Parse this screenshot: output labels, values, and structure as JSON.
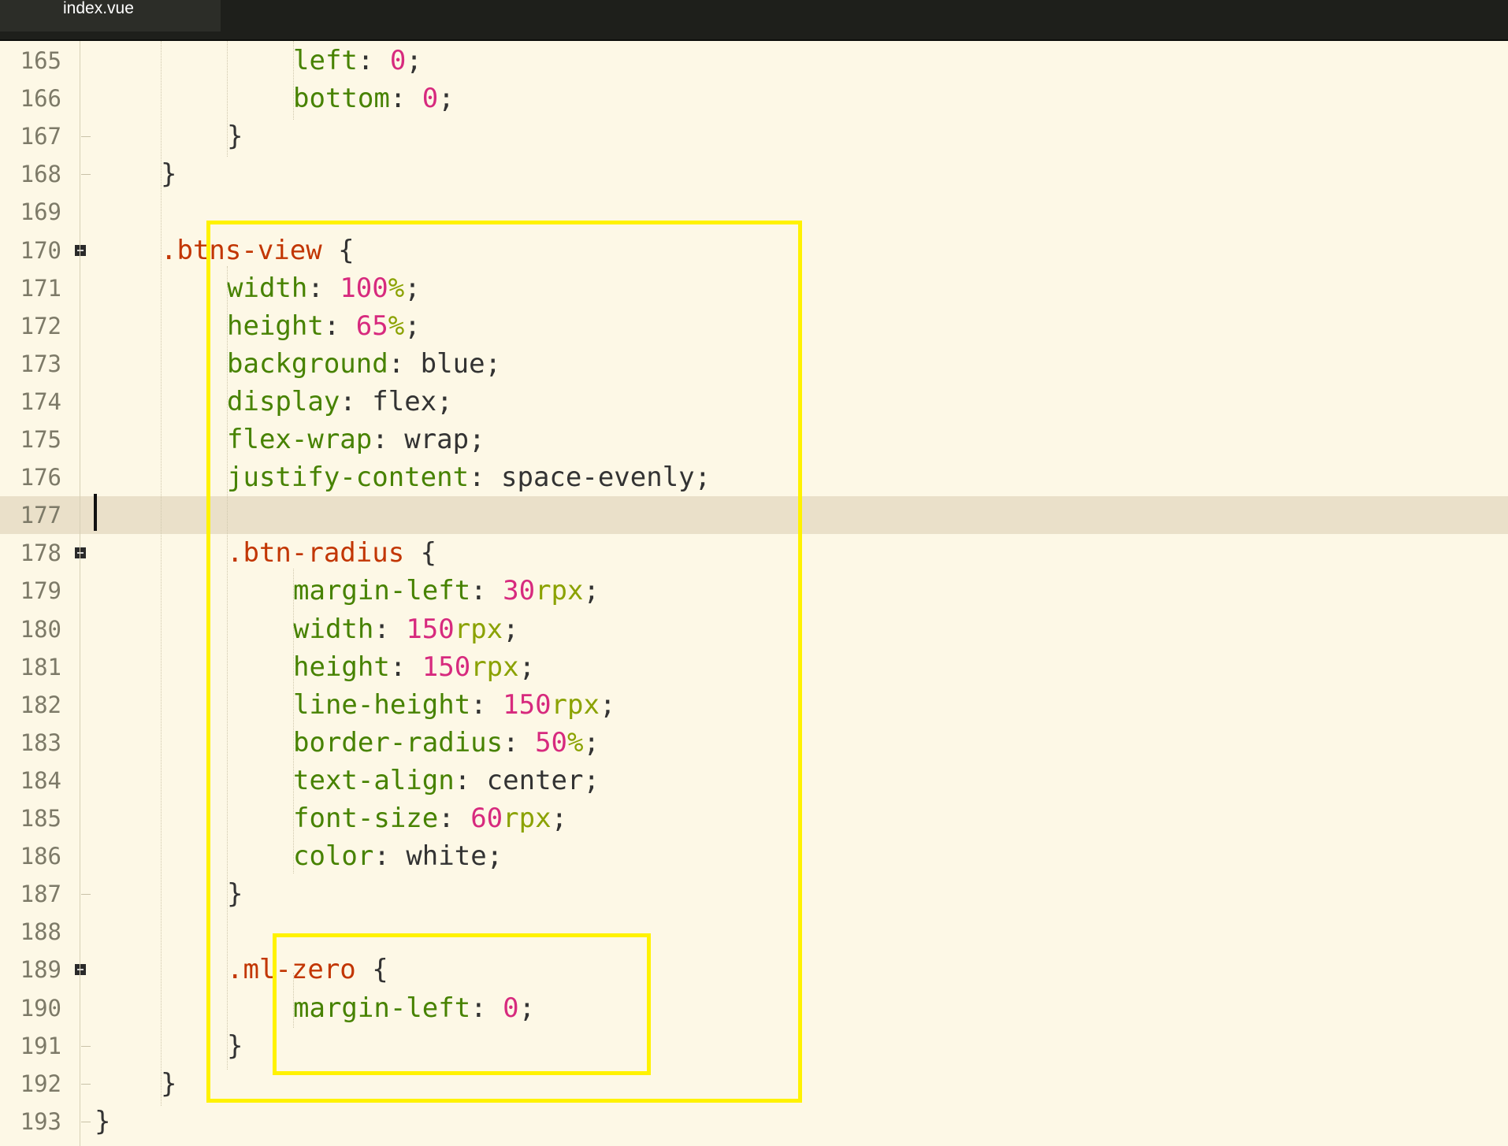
{
  "tab": {
    "filename": "index.vue"
  },
  "colors": {
    "background": "#FDF8E6",
    "active_line": "#EAE0C9",
    "property": "#478200",
    "number": "#D72A7E",
    "unit": "#8BA202",
    "selector": "#C23603",
    "highlight_box": "#FFF200"
  },
  "editor": {
    "lines": [
      {
        "number": "165",
        "tokens": [
          {
            "t": "left",
            "c": "prop"
          },
          {
            "t": ": ",
            "c": "punc"
          },
          {
            "t": "0",
            "c": "num"
          },
          {
            "t": ";",
            "c": "punc"
          }
        ]
      },
      {
        "number": "166",
        "tokens": [
          {
            "t": "bottom",
            "c": "prop"
          },
          {
            "t": ": ",
            "c": "punc"
          },
          {
            "t": "0",
            "c": "num"
          },
          {
            "t": ";",
            "c": "punc"
          }
        ]
      },
      {
        "number": "167",
        "tokens": [
          {
            "t": "}",
            "c": "punc"
          }
        ]
      },
      {
        "number": "168",
        "tokens": [
          {
            "t": "}",
            "c": "punc"
          }
        ]
      },
      {
        "number": "169",
        "tokens": []
      },
      {
        "number": "170",
        "tokens": [
          {
            "t": ".btns-view",
            "c": "sel"
          },
          {
            "t": " {",
            "c": "punc"
          }
        ]
      },
      {
        "number": "171",
        "tokens": [
          {
            "t": "width",
            "c": "prop"
          },
          {
            "t": ": ",
            "c": "punc"
          },
          {
            "t": "100",
            "c": "num"
          },
          {
            "t": "%",
            "c": "unit"
          },
          {
            "t": ";",
            "c": "punc"
          }
        ]
      },
      {
        "number": "172",
        "tokens": [
          {
            "t": "height",
            "c": "prop"
          },
          {
            "t": ": ",
            "c": "punc"
          },
          {
            "t": "65",
            "c": "num"
          },
          {
            "t": "%",
            "c": "unit"
          },
          {
            "t": ";",
            "c": "punc"
          }
        ]
      },
      {
        "number": "173",
        "tokens": [
          {
            "t": "background",
            "c": "prop"
          },
          {
            "t": ": ",
            "c": "punc"
          },
          {
            "t": "blue",
            "c": "kw"
          },
          {
            "t": ";",
            "c": "punc"
          }
        ]
      },
      {
        "number": "174",
        "tokens": [
          {
            "t": "display",
            "c": "prop"
          },
          {
            "t": ": ",
            "c": "punc"
          },
          {
            "t": "flex",
            "c": "kw"
          },
          {
            "t": ";",
            "c": "punc"
          }
        ]
      },
      {
        "number": "175",
        "tokens": [
          {
            "t": "flex-wrap",
            "c": "prop"
          },
          {
            "t": ": ",
            "c": "punc"
          },
          {
            "t": "wrap",
            "c": "kw"
          },
          {
            "t": ";",
            "c": "punc"
          }
        ]
      },
      {
        "number": "176",
        "tokens": [
          {
            "t": "justify-content",
            "c": "prop"
          },
          {
            "t": ": ",
            "c": "punc"
          },
          {
            "t": "space-evenly",
            "c": "kw"
          },
          {
            "t": ";",
            "c": "punc"
          }
        ]
      },
      {
        "number": "177",
        "tokens": []
      },
      {
        "number": "178",
        "tokens": [
          {
            "t": ".btn-radius",
            "c": "sel"
          },
          {
            "t": " {",
            "c": "punc"
          }
        ]
      },
      {
        "number": "179",
        "tokens": [
          {
            "t": "margin-left",
            "c": "prop"
          },
          {
            "t": ": ",
            "c": "punc"
          },
          {
            "t": "30",
            "c": "num"
          },
          {
            "t": "rpx",
            "c": "unit"
          },
          {
            "t": ";",
            "c": "punc"
          }
        ]
      },
      {
        "number": "180",
        "tokens": [
          {
            "t": "width",
            "c": "prop"
          },
          {
            "t": ": ",
            "c": "punc"
          },
          {
            "t": "150",
            "c": "num"
          },
          {
            "t": "rpx",
            "c": "unit"
          },
          {
            "t": ";",
            "c": "punc"
          }
        ]
      },
      {
        "number": "181",
        "tokens": [
          {
            "t": "height",
            "c": "prop"
          },
          {
            "t": ": ",
            "c": "punc"
          },
          {
            "t": "150",
            "c": "num"
          },
          {
            "t": "rpx",
            "c": "unit"
          },
          {
            "t": ";",
            "c": "punc"
          }
        ]
      },
      {
        "number": "182",
        "tokens": [
          {
            "t": "line-height",
            "c": "prop"
          },
          {
            "t": ": ",
            "c": "punc"
          },
          {
            "t": "150",
            "c": "num"
          },
          {
            "t": "rpx",
            "c": "unit"
          },
          {
            "t": ";",
            "c": "punc"
          }
        ]
      },
      {
        "number": "183",
        "tokens": [
          {
            "t": "border-radius",
            "c": "prop"
          },
          {
            "t": ": ",
            "c": "punc"
          },
          {
            "t": "50",
            "c": "num"
          },
          {
            "t": "%",
            "c": "unit"
          },
          {
            "t": ";",
            "c": "punc"
          }
        ]
      },
      {
        "number": "184",
        "tokens": [
          {
            "t": "text-align",
            "c": "prop"
          },
          {
            "t": ": ",
            "c": "punc"
          },
          {
            "t": "center",
            "c": "kw"
          },
          {
            "t": ";",
            "c": "punc"
          }
        ]
      },
      {
        "number": "185",
        "tokens": [
          {
            "t": "font-size",
            "c": "prop"
          },
          {
            "t": ": ",
            "c": "punc"
          },
          {
            "t": "60",
            "c": "num"
          },
          {
            "t": "rpx",
            "c": "unit"
          },
          {
            "t": ";",
            "c": "punc"
          }
        ]
      },
      {
        "number": "186",
        "tokens": [
          {
            "t": "color",
            "c": "prop"
          },
          {
            "t": ": ",
            "c": "punc"
          },
          {
            "t": "white",
            "c": "kw"
          },
          {
            "t": ";",
            "c": "punc"
          }
        ]
      },
      {
        "number": "187",
        "tokens": [
          {
            "t": "}",
            "c": "punc"
          }
        ]
      },
      {
        "number": "188",
        "tokens": []
      },
      {
        "number": "189",
        "tokens": [
          {
            "t": ".ml-zero",
            "c": "sel"
          },
          {
            "t": " {",
            "c": "punc"
          }
        ]
      },
      {
        "number": "190",
        "tokens": [
          {
            "t": "margin-left",
            "c": "prop"
          },
          {
            "t": ": ",
            "c": "punc"
          },
          {
            "t": "0",
            "c": "num"
          },
          {
            "t": ";",
            "c": "punc"
          }
        ]
      },
      {
        "number": "191",
        "tokens": [
          {
            "t": "}",
            "c": "punc"
          }
        ]
      },
      {
        "number": "192",
        "tokens": [
          {
            "t": "}",
            "c": "punc"
          }
        ]
      },
      {
        "number": "193",
        "tokens": [
          {
            "t": "}",
            "c": "punc"
          }
        ]
      }
    ]
  }
}
